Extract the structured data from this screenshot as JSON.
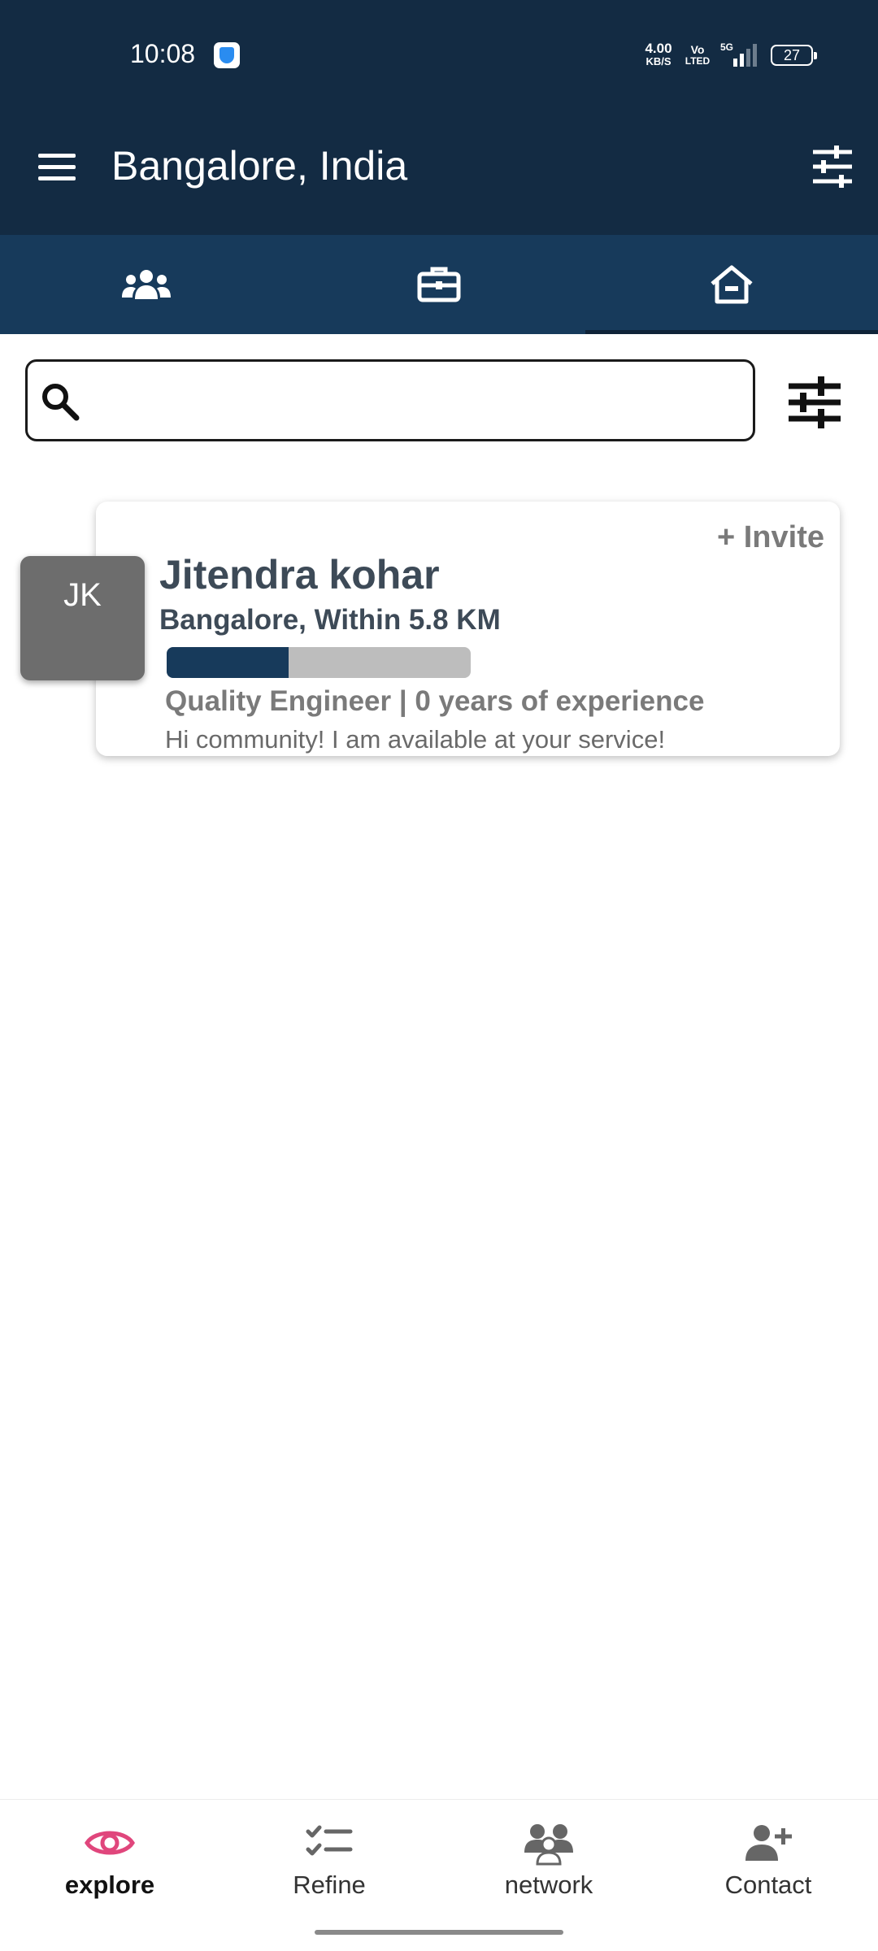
{
  "status_bar": {
    "time": "10:08",
    "net_speed_value": "4.00",
    "net_speed_unit": "KB/S",
    "volte_top": "Vo",
    "volte_bottom": "LTED",
    "network_type": "5G",
    "battery": "27"
  },
  "app_bar": {
    "title": "Bangalore, India",
    "menu_icon": "menu-icon",
    "action_icon": "tune-icon"
  },
  "tabs": [
    {
      "icon": "users-icon",
      "active": false
    },
    {
      "icon": "briefcase-icon",
      "active": false
    },
    {
      "icon": "home-icon",
      "active": true
    }
  ],
  "search": {
    "placeholder": "",
    "value": ""
  },
  "card": {
    "initials": "JK",
    "invite_label": "+ Invite",
    "name": "Jitendra kohar",
    "location": "Bangalore, Within 5.8 KM",
    "profile_completion": 0.4,
    "role": "Quality Engineer | 0 years of experience",
    "bio": "Hi community! I am available at your service!"
  },
  "bottom_nav": [
    {
      "label": "explore",
      "icon": "eye-icon",
      "active": true
    },
    {
      "label": "Refine",
      "icon": "checklist-icon",
      "active": false
    },
    {
      "label": "network",
      "icon": "network-icon",
      "active": false
    },
    {
      "label": "Contact",
      "icon": "add-contact-icon",
      "active": false
    }
  ],
  "colors": {
    "primary_dark": "#132b43",
    "tab_bar": "#173a5b",
    "accent_active": "#e0467c",
    "text_dark": "#3d4a57"
  }
}
